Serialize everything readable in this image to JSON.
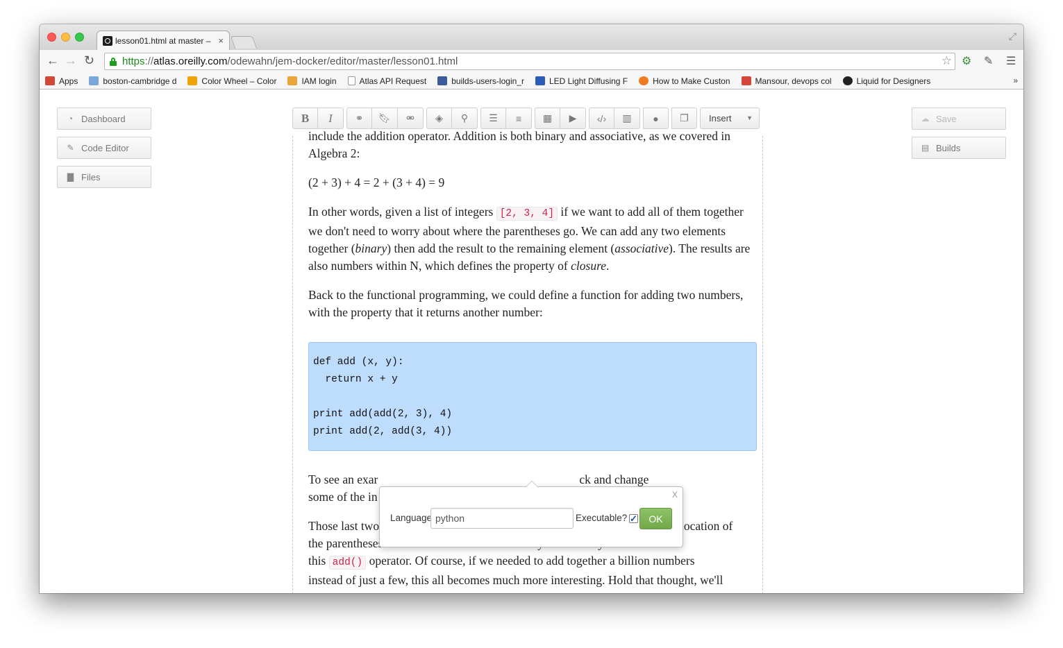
{
  "browser": {
    "tab_title": "lesson01.html at master –",
    "tab_close": "×",
    "url": {
      "scheme": "https",
      "separator": "://",
      "host": "atlas.oreilly.com",
      "path": "/odewahn/jem-docker/editor/master/lesson01.html"
    },
    "bookmarks": [
      {
        "label": "Apps",
        "icon": "apps-grid-icon",
        "color": "#d14836"
      },
      {
        "label": "boston-cambridge d",
        "icon": "folder-icon",
        "color": "#7aa7d8"
      },
      {
        "label": "Color Wheel – Color",
        "icon": "color-wheel-icon",
        "color": "#f0a30a"
      },
      {
        "label": "IAM login",
        "icon": "cube-icon",
        "color": "#e8a63a"
      },
      {
        "label": "Atlas API Request",
        "icon": "page-icon",
        "color": "#999999"
      },
      {
        "label": "builds-users-login_r",
        "icon": "grid-icon",
        "color": "#3d5a99"
      },
      {
        "label": "LED Light Diffusing F",
        "icon": "shield-icon",
        "color": "#2b5cb8"
      },
      {
        "label": "How to Make Custon",
        "icon": "instructables-icon",
        "color": "#f07b23"
      },
      {
        "label": "Mansour, devops col",
        "icon": "gmail-icon",
        "color": "#d44638"
      },
      {
        "label": "Liquid for Designers",
        "icon": "github-icon",
        "color": "#222222"
      }
    ],
    "bookmarks_more": "»"
  },
  "sidebar_left": {
    "items": [
      {
        "label": "Dashboard",
        "icon": "dashboard-icon"
      },
      {
        "label": "Code Editor",
        "icon": "pencil-icon"
      },
      {
        "label": "Files",
        "icon": "files-icon"
      }
    ]
  },
  "sidebar_right": {
    "save_label": "Save",
    "builds_label": "Builds"
  },
  "editor_toolbar": {
    "insert_label": "Insert"
  },
  "document": {
    "p1": "include the addition operator. Addition is both binary and associative, as we covered in Algebra 2:",
    "p2": "(2 + 3) + 4 = 2 + (3 + 4) = 9",
    "p3_a": "In other words, given a list of integers ",
    "p3_code": "[2, 3, 4]",
    "p3_b": " if we want to add all of them together we don't need to worry about where the parentheses go. We can add any two elements together (",
    "p3_em1": "binary",
    "p3_c": ") then add the result to the remaining element (",
    "p3_em2": "associative",
    "p3_d": "). The results are also numbers within N, which defines the property of ",
    "p3_em3": "closure",
    "p3_e": ".",
    "p4": "Back to the functional programming, we could define a function for adding two numbers, with the property that it returns another number:",
    "code_block": "def add (x, y):\n  return x + y\n\nprint add(add(2, 3), 4)\nprint add(2, add(3, 4))",
    "p5_a": "To see an exar",
    "p5_b": "ck and change",
    "p5_c": "some of the in",
    "p6_a": "Those last two",
    "p6_b": "he location of",
    "p6_c": "the parentheses doesn't matter. As it turns out Python already defines",
    "p6_d": "this ",
    "p6_code": "add()",
    "p6_e": " operator. Of course, if we needed to add together a billion numbers",
    "p6_f": "instead of just a few, this all becomes much more interesting. Hold that thought, we'll"
  },
  "popover": {
    "close": "x",
    "language_label": "Language",
    "language_value": "python",
    "executable_label": "Executable?",
    "executable_checked": true,
    "checkmark": "✓",
    "ok_label": "OK"
  }
}
